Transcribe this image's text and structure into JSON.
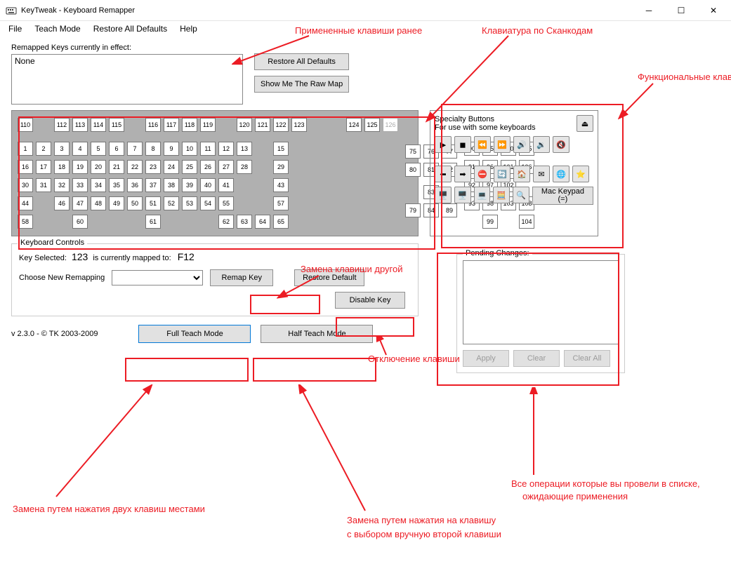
{
  "window": {
    "title": "KeyTweak -  Keyboard Remapper"
  },
  "menu": {
    "file": "File",
    "teach": "Teach Mode",
    "restore": "Restore All Defaults",
    "help": "Help"
  },
  "remapped": {
    "label": "Remapped Keys currently in effect:",
    "value": "None"
  },
  "buttons": {
    "restoreAll": "Restore All Defaults",
    "showRaw": "Show Me The Raw Map",
    "remap": "Remap Key",
    "restoreDef": "Restore Default",
    "disable": "Disable Key",
    "fullTeach": "Full Teach Mode",
    "halfTeach": "Half Teach Mode",
    "apply": "Apply",
    "clear": "Clear",
    "clearAll": "Clear All",
    "macKeypad": "Mac Keypad (=)"
  },
  "specialty": {
    "title": "Specialty Buttons",
    "subtitle": "For use with some keyboards"
  },
  "controls": {
    "legend": "Keyboard Controls",
    "keySelLabel": "Key Selected:",
    "keySelVal": "123",
    "mapLabel": "is currently mapped to:",
    "mapVal": "F12",
    "chooseLabel": "Choose New Remapping"
  },
  "pending": {
    "legend": "Pending Changes:"
  },
  "version": "v 2.3.0 - © TK 2003-2009",
  "annotations": {
    "applied": "Примененные клавиши ранее",
    "scancodes": "Клавиатура по Сканкодам",
    "funcKeys": "Функциональные клавиши",
    "replace": "Замена клавиши другой",
    "disable": "Отключение клавиши",
    "swap": "Замена путем нажатия двух клавиш местами",
    "manual1": "Замена путем нажатия на клавишу",
    "manual2": "с выбором вручную второй клавиши",
    "pending1": "Все операции которые вы провели в списке,",
    "pending2": "ожидающие применения"
  },
  "keyboard": {
    "row0": [
      "110",
      "",
      "112",
      "113",
      "114",
      "115",
      "",
      "116",
      "117",
      "118",
      "119",
      "",
      "120",
      "121",
      "122",
      "123",
      "",
      "",
      "124",
      "125",
      "126"
    ],
    "mainRows": [
      [
        "1",
        "2",
        "3",
        "4",
        "5",
        "6",
        "7",
        "8",
        "9",
        "10",
        "11",
        "12",
        "13",
        "",
        "15"
      ],
      [
        "16",
        "17",
        "18",
        "19",
        "20",
        "21",
        "22",
        "23",
        "24",
        "25",
        "26",
        "27",
        "28",
        "",
        "29"
      ],
      [
        "30",
        "31",
        "32",
        "33",
        "34",
        "35",
        "36",
        "37",
        "38",
        "39",
        "40",
        "41",
        "",
        "",
        "43"
      ],
      [
        "44",
        "",
        "46",
        "47",
        "48",
        "49",
        "50",
        "51",
        "52",
        "53",
        "54",
        "55",
        "",
        "",
        "57"
      ],
      [
        "58",
        "",
        "",
        "60",
        "",
        "",
        "",
        "61",
        "",
        "",
        "",
        "62",
        "63",
        "64",
        "65"
      ]
    ],
    "nav": [
      [
        "75",
        "76",
        "77"
      ],
      [
        "80",
        "81",
        "82"
      ],
      [
        "",
        "83",
        ""
      ],
      [
        "79",
        "84",
        "89"
      ]
    ],
    "num": [
      [
        "90",
        "95",
        "100",
        "105"
      ],
      [
        "91",
        "96",
        "101",
        "106"
      ],
      [
        "92",
        "97",
        "102",
        ""
      ],
      [
        "93",
        "98",
        "103",
        "108"
      ],
      [
        "",
        "99",
        "",
        "104"
      ]
    ]
  }
}
